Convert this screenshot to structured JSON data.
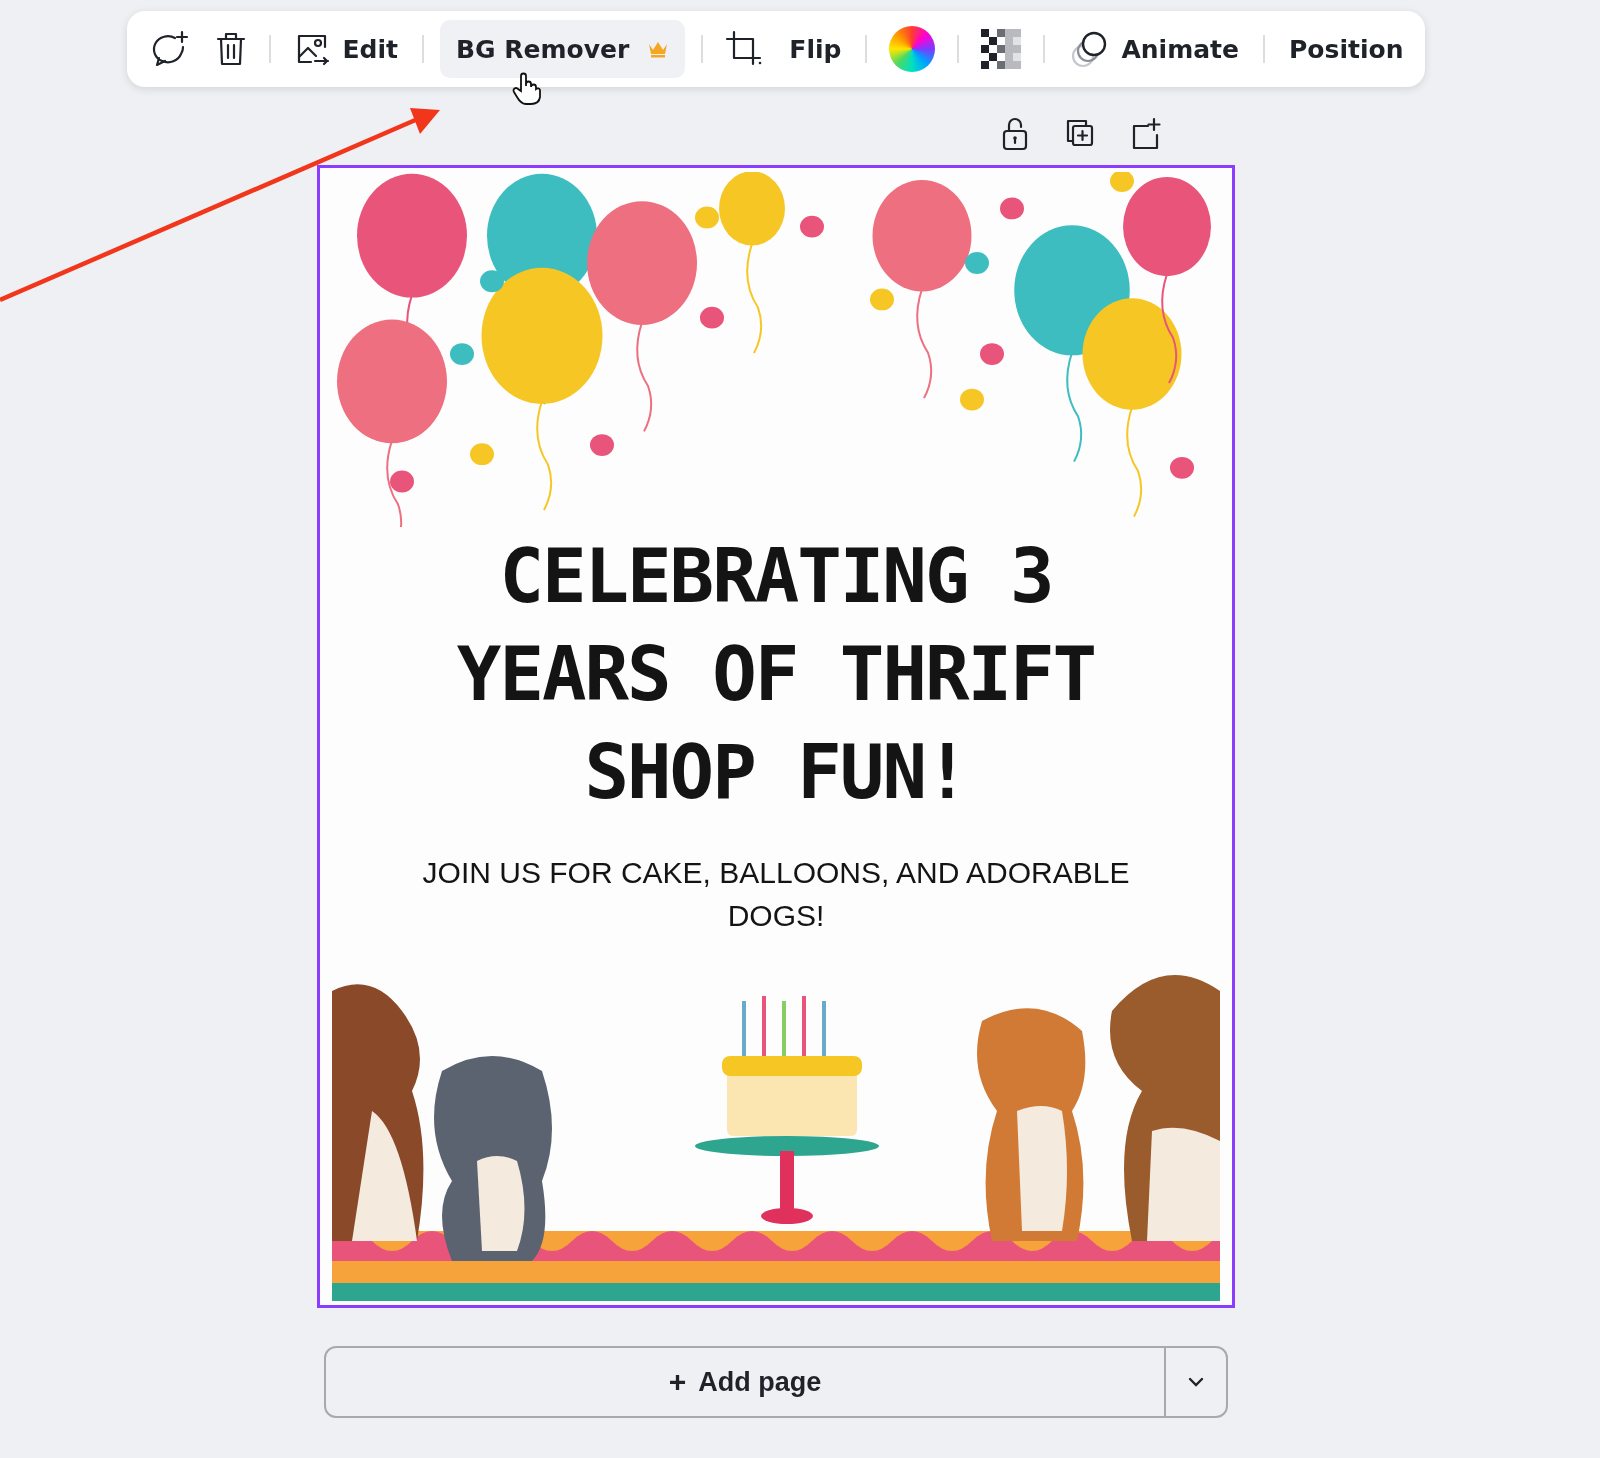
{
  "toolbar": {
    "groups": [
      [
        {
          "kind": "comment-add"
        },
        {
          "kind": "delete"
        }
      ],
      [
        {
          "kind": "edit-image",
          "label": "Edit"
        }
      ],
      [
        {
          "kind": "text",
          "label": "BG Remover",
          "highlighted": true,
          "premium": true
        }
      ],
      [
        {
          "kind": "crop"
        },
        {
          "kind": "text",
          "label": "Flip"
        }
      ],
      [
        {
          "kind": "color-wheel"
        }
      ],
      [
        {
          "kind": "transparency"
        }
      ],
      [
        {
          "kind": "animate",
          "label": "Animate"
        }
      ],
      [
        {
          "kind": "text",
          "label": "Position"
        }
      ]
    ]
  },
  "page_actions": [
    {
      "kind": "lock"
    },
    {
      "kind": "duplicate"
    },
    {
      "kind": "add"
    }
  ],
  "design": {
    "selected": true,
    "title": "CELEBRATING 3 YEARS OF THRIFT SHOP FUN!",
    "subtitle": "JOIN US FOR CAKE, BALLOONS, AND ADORABLE DOGS!"
  },
  "add_page": {
    "label": "Add page",
    "icon": "+"
  }
}
